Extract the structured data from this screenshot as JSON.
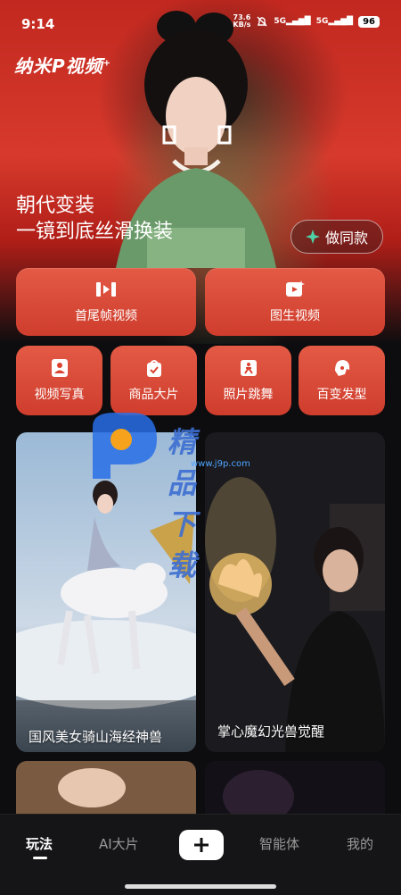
{
  "status_bar": {
    "time": "9:14",
    "net_speed_value": "73.6",
    "net_speed_unit": "KB/s",
    "signal1": "5G",
    "signal2": "5G",
    "battery": "96"
  },
  "app": {
    "logo_text": "纳米P视频"
  },
  "hero": {
    "line1": "朝代变装",
    "line2": "一镜到底丝滑换装",
    "same_button": "做同款"
  },
  "features": {
    "big": [
      {
        "label": "首尾帧视频",
        "icon": "first-last-frame-icon"
      },
      {
        "label": "图生视频",
        "icon": "image-to-video-icon"
      }
    ],
    "small": [
      {
        "label": "视频写真",
        "icon": "portrait-video-icon"
      },
      {
        "label": "商品大片",
        "icon": "product-icon"
      },
      {
        "label": "照片跳舞",
        "icon": "photo-dance-icon"
      },
      {
        "label": "百变发型",
        "icon": "hairstyle-icon"
      }
    ]
  },
  "watermark": {
    "title": "精品下载",
    "url": "www.j9p.com"
  },
  "feed": [
    {
      "title": "国风美女骑山海经神兽"
    },
    {
      "title": "掌心魔幻光兽觉醒"
    }
  ],
  "bottom_nav": {
    "items": [
      {
        "label": "玩法"
      },
      {
        "label": "AI大片"
      },
      {
        "label": "智能体"
      },
      {
        "label": "我的"
      }
    ],
    "active": "玩法"
  },
  "colors": {
    "accent": "#d9432f",
    "background": "#0d0d0f"
  }
}
